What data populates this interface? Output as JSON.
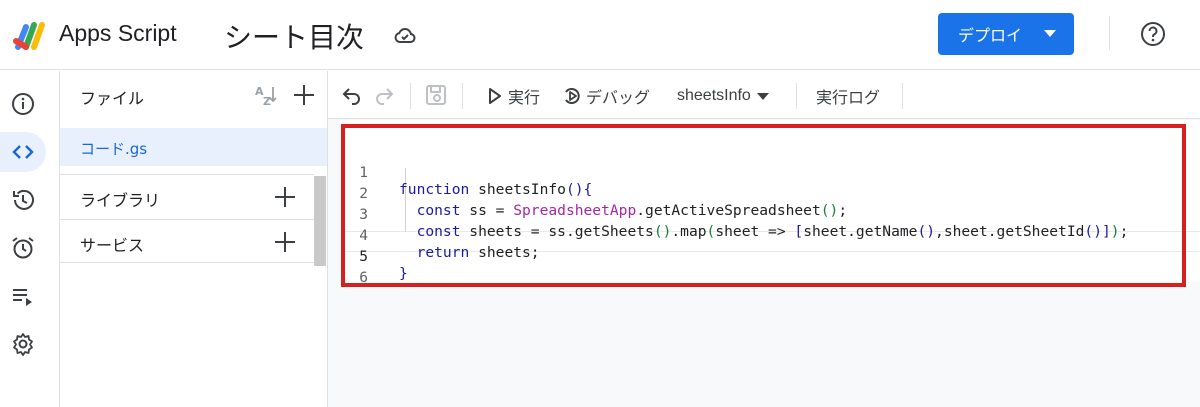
{
  "header": {
    "app_name": "Apps Script",
    "project_title": "シート目次",
    "deploy_label": "デプロイ"
  },
  "rail": {
    "items": [
      {
        "icon": "info-icon",
        "label": "Overview"
      },
      {
        "icon": "code-icon",
        "label": "Editor",
        "active": true
      },
      {
        "icon": "history-icon",
        "label": "History"
      },
      {
        "icon": "alarm-icon",
        "label": "Triggers"
      },
      {
        "icon": "executions-icon",
        "label": "Executions"
      },
      {
        "icon": "gear-icon",
        "label": "Settings"
      }
    ]
  },
  "files": {
    "title": "ファイル",
    "items": [
      {
        "name": "コード.gs",
        "selected": true
      }
    ],
    "sections": [
      {
        "label": "ライブラリ"
      },
      {
        "label": "サービス"
      }
    ]
  },
  "toolbar": {
    "run_label": "実行",
    "debug_label": "デバッグ",
    "function_select": "sheetsInfo",
    "log_label": "実行ログ"
  },
  "code": {
    "line_numbers": [
      "1",
      "2",
      "3",
      "4",
      "5",
      "6"
    ],
    "active_line": 5,
    "lines": [
      "function sheetsInfo(){",
      "  const ss = SpreadsheetApp.getActiveSpreadsheet();",
      "  const sheets = ss.getSheets().map(sheet => [sheet.getName(),sheet.getSheetId()]);",
      "  return sheets;",
      "}",
      ""
    ]
  },
  "colors": {
    "accent": "#1a73e8",
    "highlight_border": "#d61f1f",
    "keyword": "#1a1aa6",
    "class_name": "#a626a4"
  }
}
